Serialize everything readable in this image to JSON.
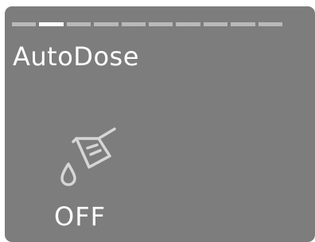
{
  "screen": {
    "page_indicator": {
      "total": 10,
      "active_index": 1
    },
    "title": "AutoDose",
    "icon": "measuring-cup-dose-icon",
    "status": "OFF"
  },
  "colors": {
    "background": "#7d7d7d",
    "text": "#ffffff",
    "indicator_inactive": "#b9b9b9",
    "indicator_active": "#ffffff"
  }
}
